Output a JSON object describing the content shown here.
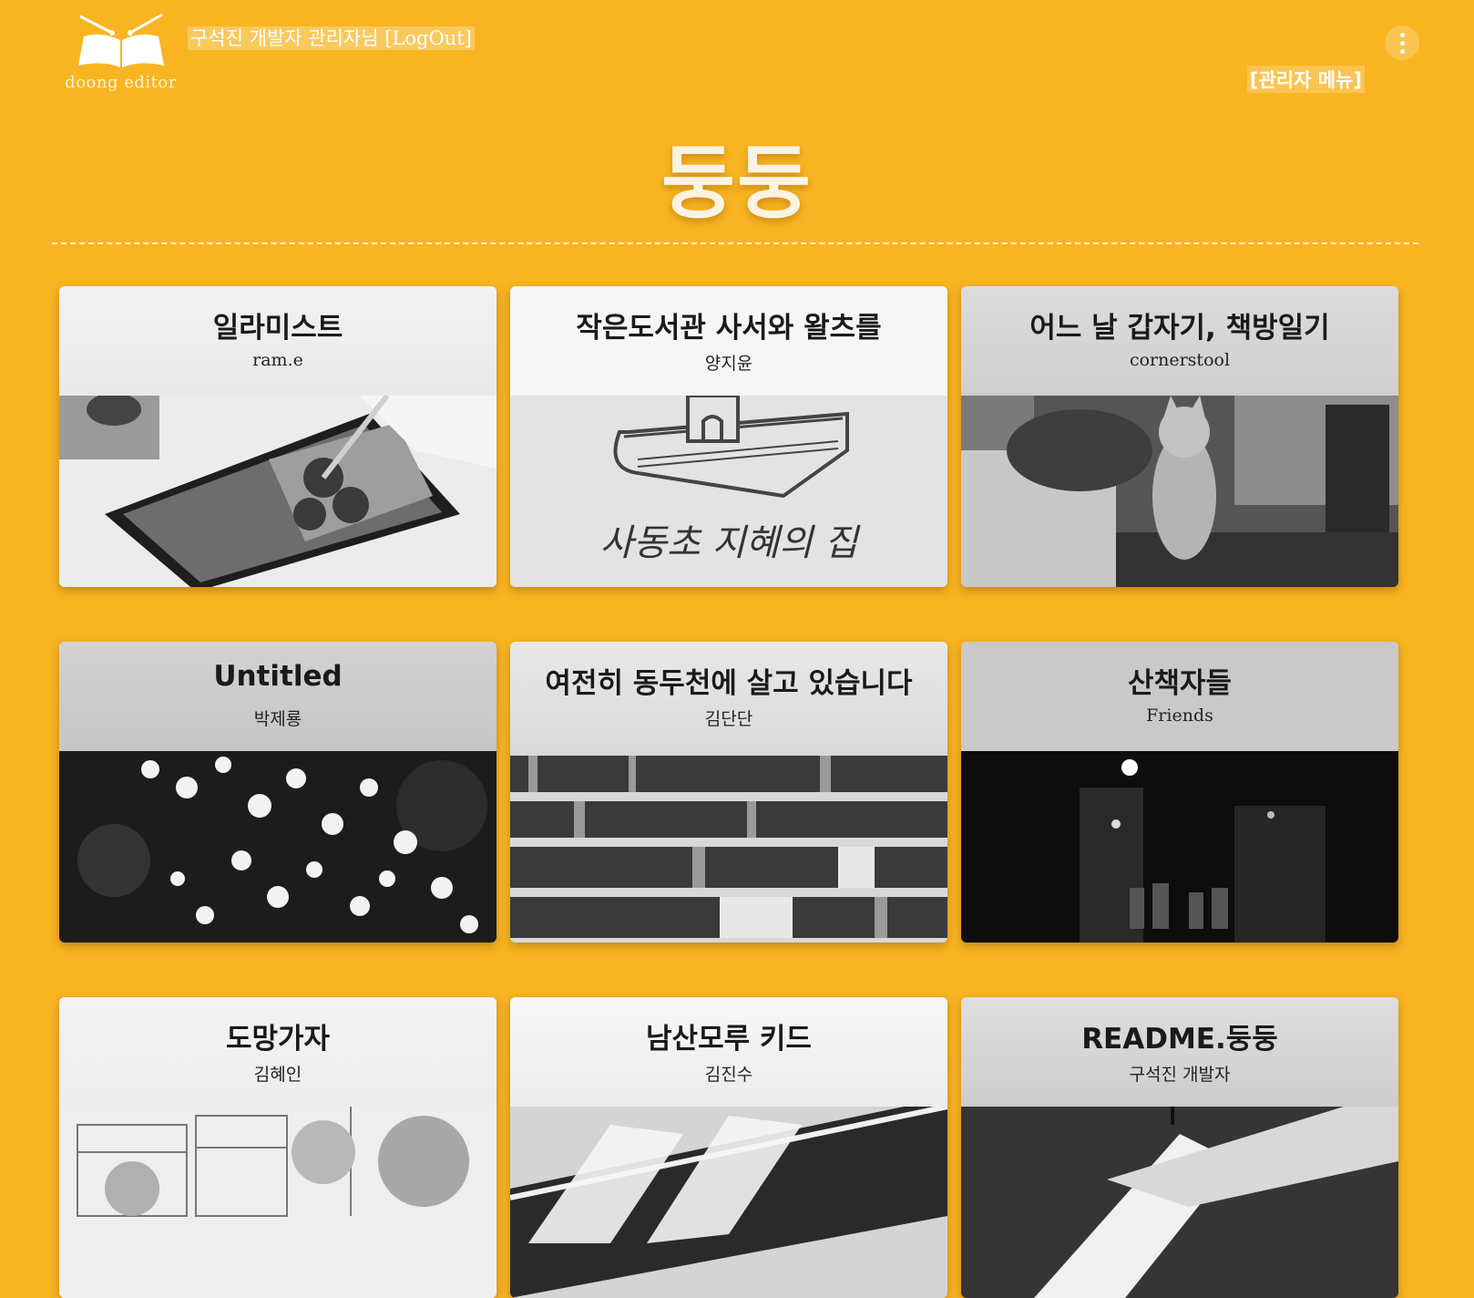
{
  "header": {
    "logo_text": "doong editor",
    "user_line": "구석진 개발자 관리자님 [LogOut]",
    "admin_menu": "[관리자 메뉴]",
    "site_title": "둥둥"
  },
  "colors": {
    "background": "#f9b421",
    "title_text": "#fbf3e2"
  },
  "cards": [
    {
      "title": "일라미스트",
      "author": "ram.e",
      "image": "tablet-drawing-photo"
    },
    {
      "title": "작은도서관 사서와 왈츠를",
      "author": "양지윤",
      "image": "book-illustration"
    },
    {
      "title": "어느 날 갑자기, 책방일기",
      "author": "cornerstool",
      "image": "bookstore-cat-photo"
    },
    {
      "title": "Untitled",
      "author": "박제룡",
      "image": "blossom-photo"
    },
    {
      "title": "여전히 동두천에 살고 있습니다",
      "author": "김단단",
      "image": "bookshelf-photo"
    },
    {
      "title": "산책자들",
      "author": "Friends",
      "image": "night-alley-photo"
    },
    {
      "title": "도망가자",
      "author": "김혜인",
      "image": "building-sketch"
    },
    {
      "title": "남산모루 키드",
      "author": "김진수",
      "image": "snickers-photo"
    },
    {
      "title": "README.둥둥",
      "author": "구석진 개발자",
      "image": "abstract-shape"
    }
  ],
  "illustration_text": "사동초 지혜의 집"
}
